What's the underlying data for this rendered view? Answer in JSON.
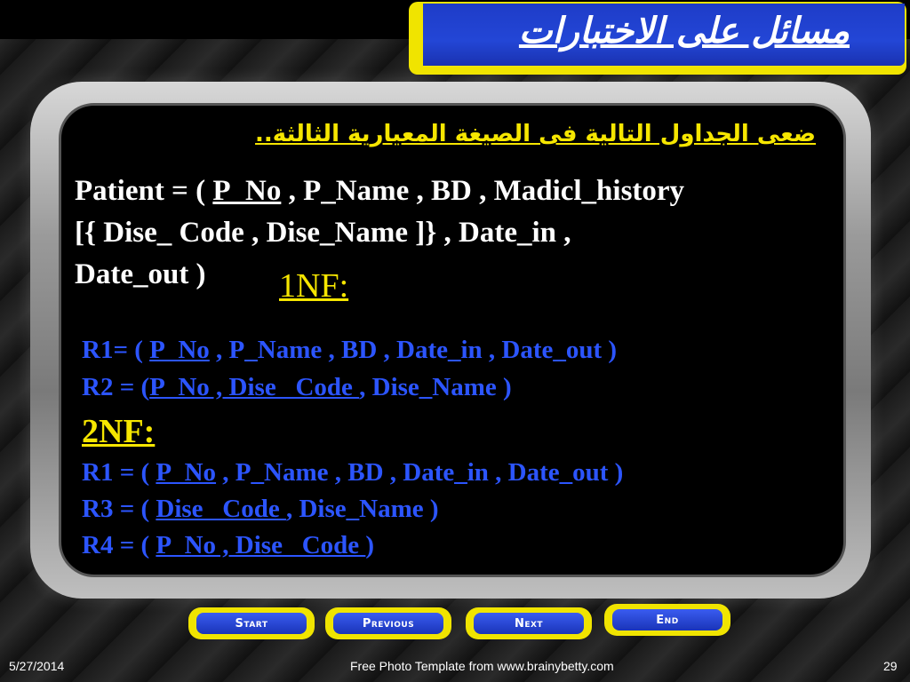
{
  "title": "مسائل على الاختبارات",
  "instruction": "ضعى الجداول التالية فى الصيغة المعيارية الثالثة..",
  "patient": {
    "prefix": "Patient = ( ",
    "key": "P_No",
    "line1_rest": " , P_Name , BD , Madicl_history",
    "line2": "[{ Dise_ Code , Dise_Name ]} , Date_in ,",
    "line3": "Date_out )"
  },
  "nf1": {
    "label": "1NF:",
    "r1": {
      "prefix": "R1= ( ",
      "key": "P_No",
      "rest": " , P_Name , BD , Date_in , Date_out )"
    },
    "r2": {
      "prefix": "R2 = (",
      "key": "P_No , Dise_ Code ",
      "rest": ", Dise_Name )"
    }
  },
  "nf2": {
    "label": "2NF:",
    "r1": {
      "prefix": "R1 = ( ",
      "key": "P_No",
      "rest": " , P_Name , BD , Date_in , Date_out )"
    },
    "r3": {
      "prefix": "R3 = ( ",
      "key": "Dise_ Code ",
      "rest": ", Dise_Name )"
    },
    "r4": {
      "prefix": "R4 = ( ",
      "key": "P_No , Dise_ Code ",
      "rest": ")"
    }
  },
  "nav": {
    "start": "Start",
    "previous": "Previous",
    "next": "Next",
    "end": "End"
  },
  "footer": {
    "date": "5/27/2014",
    "credit": "Free Photo Template from www.brainybetty.com",
    "page": "29"
  },
  "colors": {
    "accent_yellow": "#f0e400",
    "title_blue": "#2346d6",
    "relation_blue": "#2c55ff"
  }
}
